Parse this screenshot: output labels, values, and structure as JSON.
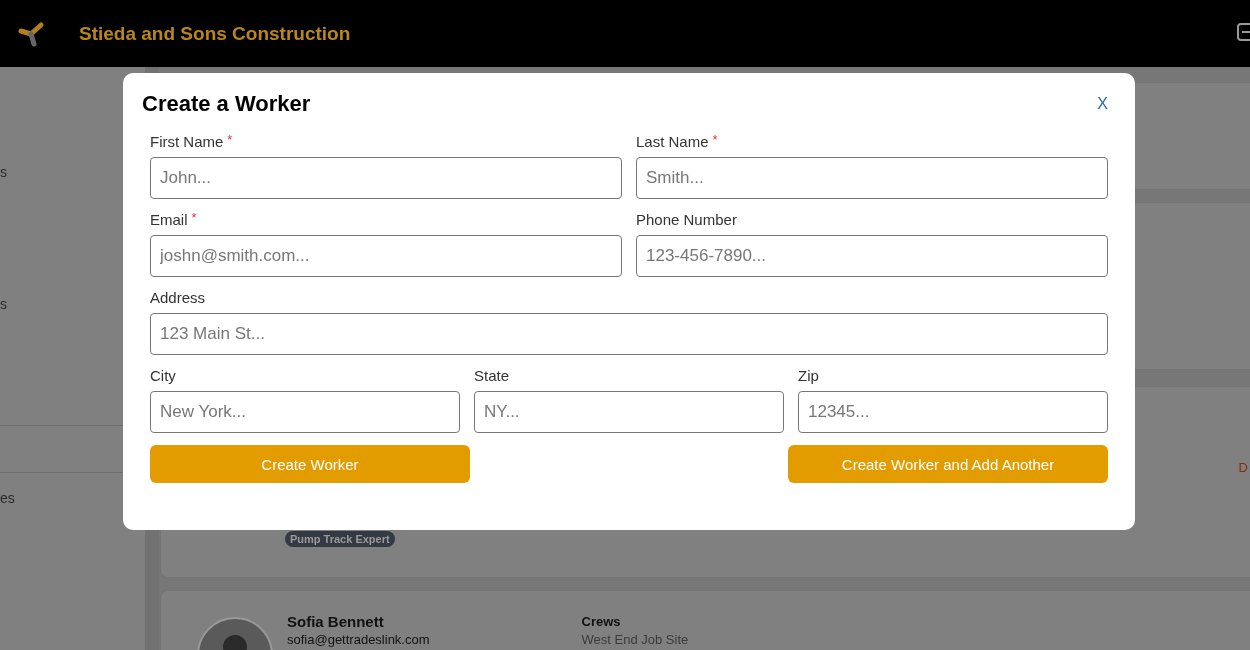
{
  "header": {
    "company": "Stieda and Sons Construction"
  },
  "sidebar": {
    "items": [
      {
        "label": "s"
      },
      {
        "label": "s"
      },
      {
        "label": "es"
      }
    ]
  },
  "workers": [
    {
      "skills": [
        "Pump Track Expert"
      ],
      "action": "D"
    },
    {
      "name": "Sofia Bennett",
      "email": "sofia@gettradeslink.com",
      "crews_label": "Crews",
      "crew": "West End Job Site"
    }
  ],
  "modal": {
    "title": "Create a Worker",
    "close": "X",
    "rows": [
      {
        "fields": [
          {
            "label": "First Name",
            "marker": "*",
            "placeholder": "John..."
          },
          {
            "label": "Last Name",
            "marker": "*",
            "placeholder": "Smith..."
          }
        ]
      },
      {
        "fields": [
          {
            "label": "Email",
            "marker": "*",
            "placeholder": "joshn@smith.com..."
          },
          {
            "label": "Phone Number",
            "placeholder": "123-456-7890..."
          }
        ]
      },
      {
        "fields": [
          {
            "label": "Address",
            "placeholder": "123 Main St..."
          }
        ]
      },
      {
        "fields": [
          {
            "label": "City",
            "placeholder": "New York..."
          },
          {
            "label": "State",
            "placeholder": "NY..."
          },
          {
            "label": "Zip",
            "placeholder": "12345..."
          }
        ]
      }
    ],
    "buttons": [
      "Create Worker",
      "Create Worker and Add Another"
    ]
  }
}
